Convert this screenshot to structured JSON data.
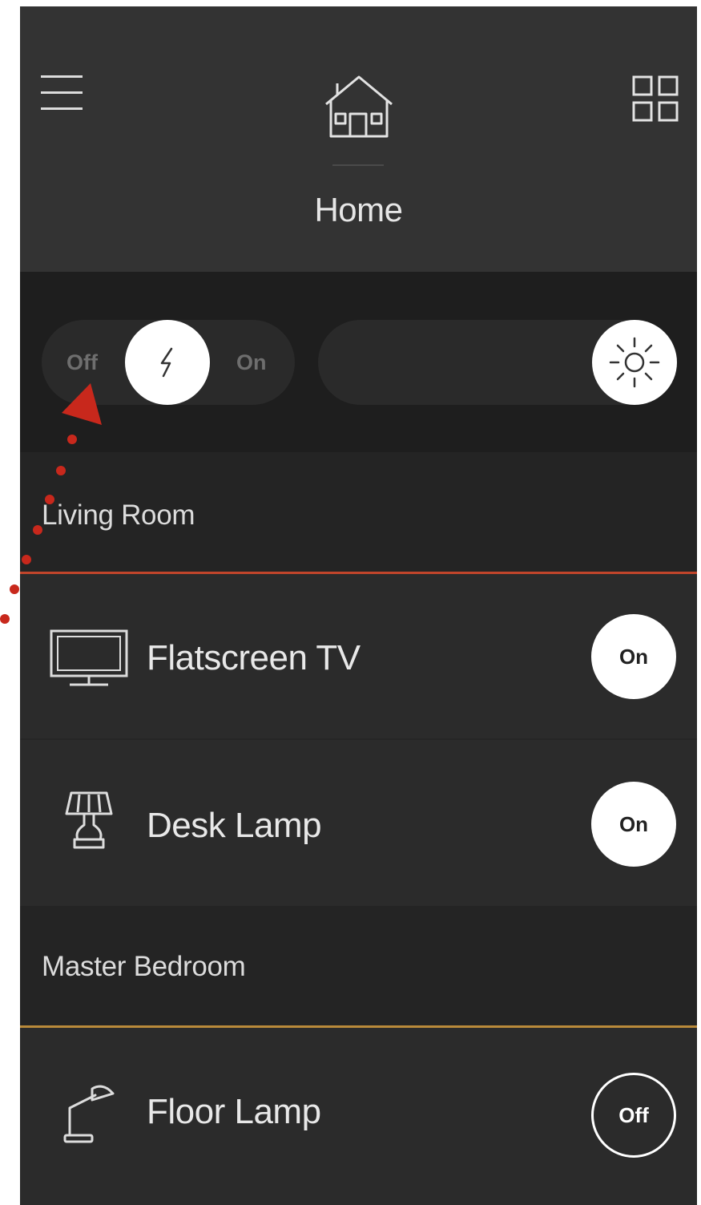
{
  "header": {
    "title": "Home",
    "menu_icon": "hamburger-menu-icon",
    "home_icon": "house-icon",
    "grid_icon": "grid-view-icon"
  },
  "master_toggle": {
    "off_label": "Off",
    "on_label": "On",
    "knob_icon": "lightning-bolt-icon"
  },
  "brightness": {
    "icon": "sun-icon",
    "level": 1.0
  },
  "rooms": [
    {
      "name": "Living Room",
      "accent": "#c2452b",
      "devices": [
        {
          "name": "Flatscreen TV",
          "icon": "tv-icon",
          "state": "On"
        },
        {
          "name": "Desk Lamp",
          "icon": "desk-lamp-icon",
          "state": "On"
        }
      ]
    },
    {
      "name": "Master Bedroom",
      "accent": "#b98a3a",
      "devices": [
        {
          "name": "Floor Lamp",
          "icon": "floor-lamp-icon",
          "state": "Off"
        }
      ]
    }
  ],
  "annotation_color": "#c8281c"
}
